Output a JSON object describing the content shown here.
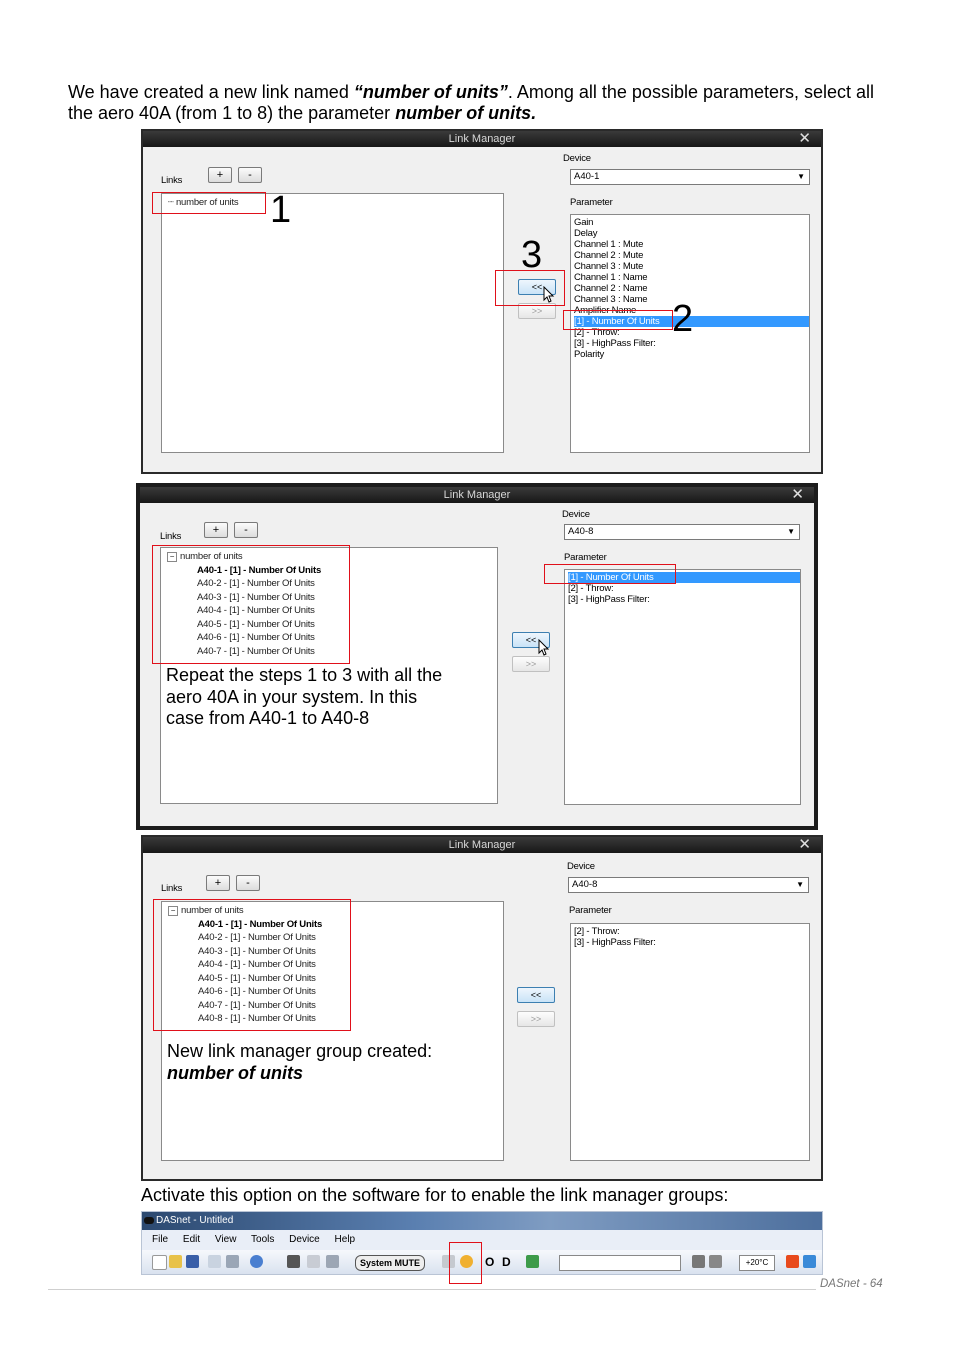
{
  "intro": {
    "text1": "We have created a new link named ",
    "link_name": "“number of units”",
    "text2": ". Among all the possible parameters, select all the aero 40A (from 1 to 8) the parameter ",
    "param_name": "number of units",
    "text3": "."
  },
  "dialog_common": {
    "title": "Link Manager",
    "close": "✕",
    "links_label": "Links",
    "add_label": "+",
    "remove_label": "-",
    "device_label": "Device",
    "parameter_label": "Parameter",
    "assign_label": "<<",
    "unassign_label": ">>"
  },
  "dialog1": {
    "device": "A40-1",
    "tree_root": "number of units",
    "parameters": [
      "Gain",
      "Delay",
      "Channel 1 : Mute",
      "Channel 2 : Mute",
      "Channel 3 : Mute",
      "Channel 1 : Name",
      "Channel 2 : Name",
      "Channel 3 : Name",
      "Amplifier Name",
      "[1] - Number Of Units",
      "[2] - Throw:",
      "[3] - HighPass Filter:",
      "Polarity"
    ],
    "selected_index": 9,
    "steps": [
      "1",
      "2",
      "3"
    ]
  },
  "dialog2": {
    "device": "A40-8",
    "tree_root": "number of units",
    "tree_children": [
      "A40-1 - [1] - Number Of Units",
      "A40-2 - [1] - Number Of Units",
      "A40-3 - [1] - Number Of Units",
      "A40-4 - [1] - Number Of Units",
      "A40-5 - [1] - Number Of Units",
      "A40-6 - [1] - Number Of Units",
      "A40-7 - [1] - Number Of Units"
    ],
    "parameters": [
      "[1] - Number Of Units",
      "[2] - Throw:",
      "[3] - HighPass Filter:"
    ],
    "selected_index": 0,
    "note_line1": "Repeat the steps 1 to 3 with all the",
    "note_line2": "aero 40A in your system. In this",
    "note_line3": "case from A40-1 to A40-8"
  },
  "dialog3": {
    "device": "A40-8",
    "tree_root": "number of units",
    "tree_children": [
      "A40-1 - [1] - Number Of Units",
      "A40-2 - [1] - Number Of Units",
      "A40-3 - [1] - Number Of Units",
      "A40-4 - [1] - Number Of Units",
      "A40-5 - [1] - Number Of Units",
      "A40-6 - [1] - Number Of Units",
      "A40-7 - [1] - Number Of Units",
      "A40-8 - [1] - Number Of Units"
    ],
    "parameters": [
      "[2] - Throw:",
      "[3] - HighPass Filter:"
    ],
    "note_line1": "New link manager group created:",
    "note_line2": "number of units"
  },
  "activate_text": "Activate this option on the software for to enable the link manager groups:",
  "app": {
    "title": "DASnet - Untitled",
    "menu": [
      "File",
      "Edit",
      "View",
      "Tools",
      "Device",
      "Help"
    ],
    "system_mute": "System MUTE",
    "o_label": "O",
    "d_label": "D",
    "temperature": "+20°C"
  },
  "footer": "DASnet  - 64"
}
